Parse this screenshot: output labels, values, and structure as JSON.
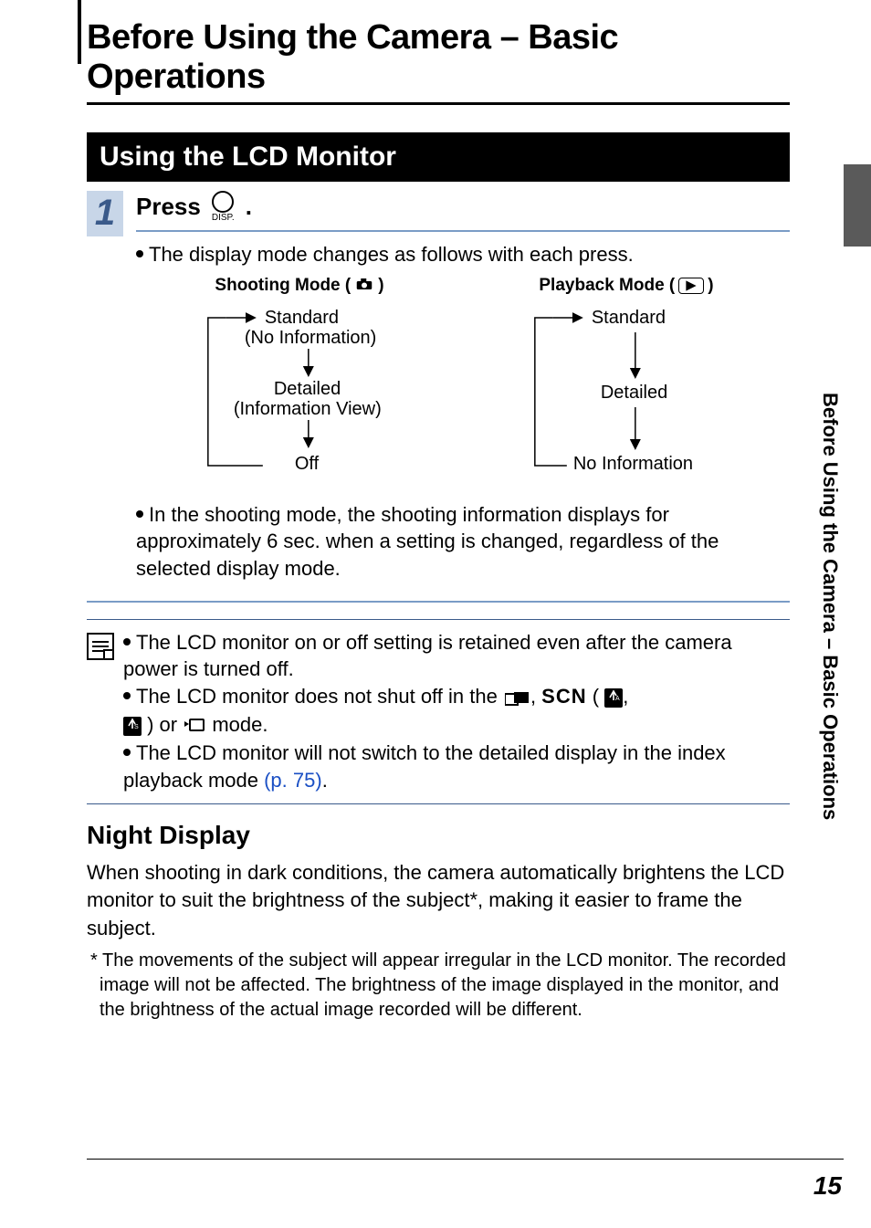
{
  "chapter_title": "Before Using the Camera – Basic Operations",
  "side_label": "Before Using the Camera – Basic Operations",
  "page_number": "15",
  "section_title": "Using the LCD Monitor",
  "step": {
    "number": "1",
    "press_label": "Press",
    "press_suffix": ".",
    "disp_label": "DISP.",
    "bullet1": "The display mode changes as follows with each press.",
    "shoot_title_pre": "Shooting Mode (",
    "shoot_title_post": ")",
    "play_title_pre": "Playback Mode (",
    "play_title_post": ")",
    "shoot_items": {
      "a1": "Standard",
      "a2": "(No Information)",
      "b1": "Detailed",
      "b2": "(Information View)",
      "c": "Off"
    },
    "play_items": {
      "a": "Standard",
      "b": "Detailed",
      "c": "No Information"
    },
    "bullet2": "In the shooting mode, the shooting information displays for approximately 6 sec. when a setting is changed, regardless of the selected display mode."
  },
  "notes": {
    "n1": "The LCD monitor on or off setting is retained even after the camera power is turned off.",
    "n2_a": "The LCD monitor does not shut off in the ",
    "n2_b": ", ",
    "n2_scn": "SCN",
    "n2_c": " ( ",
    "n2_d": ", ",
    "n2_e": " ) or ",
    "n2_f": " mode.",
    "n3_a": "The LCD monitor will not switch to the detailed display in the index playback mode ",
    "n3_link": "(p. 75)",
    "n3_b": "."
  },
  "subheading": "Night Display",
  "para": "When shooting in dark conditions, the camera automatically brightens the LCD monitor to suit the brightness of the subject*, making it easier to frame the subject.",
  "footnote": "* The movements of the subject will appear irregular in the LCD monitor. The recorded image will not be affected. The brightness of the image displayed in the monitor, and the brightness of the actual image recorded will be different."
}
